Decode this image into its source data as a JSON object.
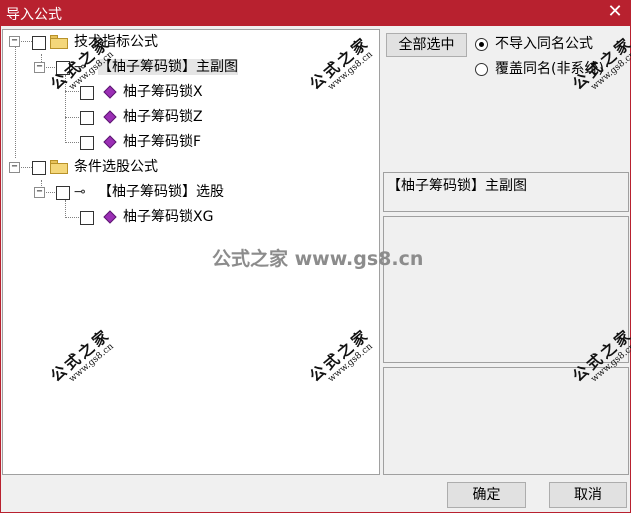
{
  "window": {
    "title": "导入公式"
  },
  "tree": {
    "nodes": [
      {
        "label": "技术指标公式"
      },
      {
        "label": "【柚子筹码锁】主副图"
      },
      {
        "label": "柚子筹码锁X"
      },
      {
        "label": "柚子筹码锁Z"
      },
      {
        "label": "柚子筹码锁F"
      },
      {
        "label": "条件选股公式"
      },
      {
        "label": "【柚子筹码锁】选股"
      },
      {
        "label": "柚子筹码锁XG"
      }
    ],
    "expander_symbol": "−"
  },
  "buttons": {
    "select_all": "全部选中",
    "ok": "确定",
    "cancel": "取消"
  },
  "options": {
    "radio_skip": "不导入同名公式",
    "radio_overwrite": "覆盖同名(非系统)",
    "selected": "radio_skip"
  },
  "info": {
    "formula_name": "【柚子筹码锁】主副图"
  },
  "watermark": {
    "line1": "公式之家",
    "line2": "www.gs8.cn",
    "center": "公式之家 www.gs8.cn"
  },
  "colors": {
    "titlebar": "#b8212f",
    "gem": "#9b2fb5"
  }
}
